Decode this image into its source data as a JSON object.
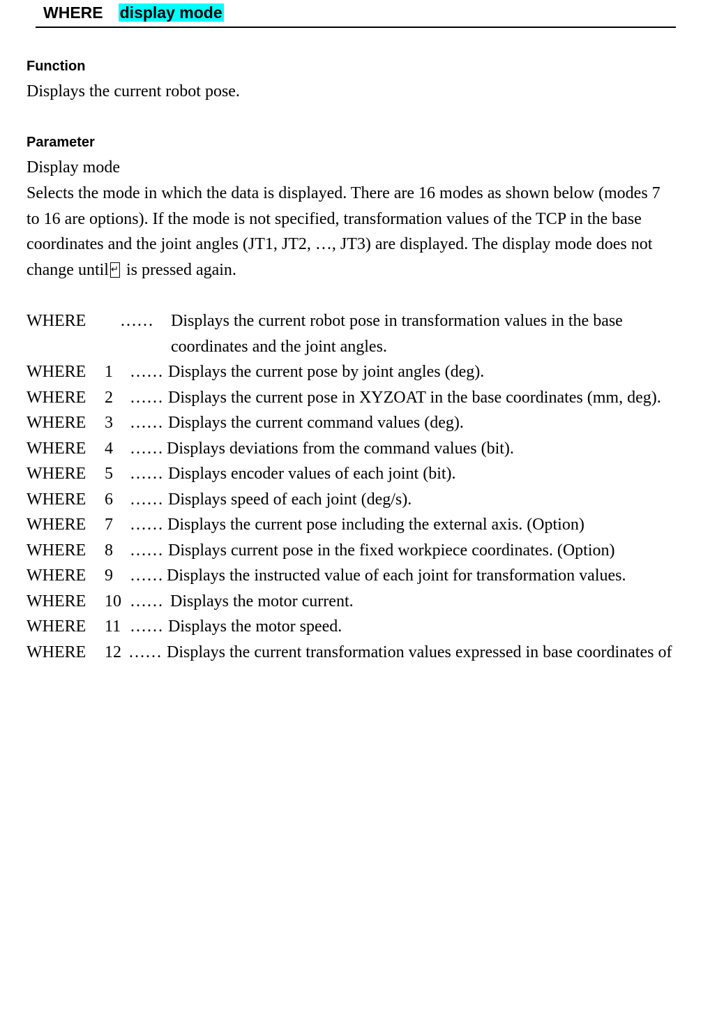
{
  "header": {
    "command": "WHERE",
    "argument": "display mode"
  },
  "function": {
    "title": "Function",
    "text": "Displays the current robot pose."
  },
  "parameter": {
    "title": "Parameter",
    "name": "Display mode",
    "lines": [
      "Selects the mode in which the data is displayed.    There are 16 modes as shown below (modes 7",
      "to 16 are options).    If the mode is not specified, transformation values of the TCP in the base",
      "coordinates and the joint angles (JT1, JT2, …, JT3) are displayed.    The display mode does not"
    ],
    "last_line_before": "change until",
    "return_key_icon": "return-key-icon",
    "last_line_after": " is pressed again."
  },
  "modes": [
    {
      "keyword": "WHERE",
      "number": "",
      "dots": "……",
      "desc_line1": "Displays the current robot pose in transformation values in the base",
      "desc_line2": "coordinates and the joint angles."
    },
    {
      "keyword": "WHERE",
      "number": "1",
      "dots": "……",
      "desc": "Displays the current pose by joint angles (deg)."
    },
    {
      "keyword": "WHERE",
      "number": "2",
      "dots": "……",
      "desc": "Displays the current pose in XYZOAT in the base coordinates (mm, deg)."
    },
    {
      "keyword": "WHERE",
      "number": "3",
      "dots": "……",
      "desc": "Displays the current command values (deg)."
    },
    {
      "keyword": "WHERE",
      "number": "4",
      "dots": "……",
      "desc": "Displays deviations from the command values (bit)."
    },
    {
      "keyword": "WHERE",
      "number": "5",
      "dots": "……",
      "desc": "Displays encoder values of each joint (bit)."
    },
    {
      "keyword": "WHERE",
      "number": "6",
      "dots": "……",
      "desc": "Displays speed of each joint (deg/s)."
    },
    {
      "keyword": "WHERE",
      "number": "7",
      "dots": "……",
      "desc": "Displays the current pose including the external axis. (Option)"
    },
    {
      "keyword": "WHERE",
      "number": "8",
      "dots": "……",
      "desc": "Displays current pose in the fixed workpiece coordinates.    (Option)"
    },
    {
      "keyword": "WHERE",
      "number": "9",
      "dots": "……",
      "desc": "Displays the instructed value of each joint for transformation values."
    },
    {
      "keyword": "WHERE",
      "number": "10",
      "dots": "……",
      "desc": "Displays the motor current."
    },
    {
      "keyword": "WHERE",
      "number": "11",
      "dots": "……",
      "desc": "Displays the motor speed."
    },
    {
      "keyword": "WHERE",
      "number": "12",
      "dots": "……",
      "desc": "Displays the current transformation values expressed in base coordinates of"
    }
  ]
}
